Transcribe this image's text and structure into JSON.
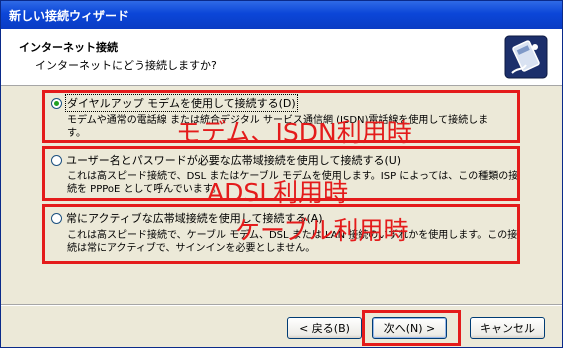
{
  "window": {
    "title": "新しい接続ウィザード"
  },
  "header": {
    "title": "インターネット接続",
    "subtitle": "インターネットにどう接続しますか?",
    "icon": "phone-plug-icon"
  },
  "options": [
    {
      "label": "ダイヤルアップ モデムを使用して接続する(D)",
      "checked": true,
      "description": [
        "モデムや通常の電話線 または統合デジタル サービス通信網 (ISDN)電話線を使用して接続しま",
        "す。"
      ],
      "annotation": "モデム、ISDN利用時"
    },
    {
      "label": "ユーザー名とパスワードが必要な広帯域接続を使用して接続する(U)",
      "checked": false,
      "description": [
        "これは高スピード接続で、DSL またはケーブル モデムを使用します。ISP によっては、この種類の接",
        "続を PPPoE として呼んでいます。"
      ],
      "annotation": "ADSL利用時"
    },
    {
      "label": "常にアクティブな広帯域接続を使用して接続する(A)",
      "checked": false,
      "description": [
        "これは高スピード接続で、ケーブル モデム、DSL または LAN 接続のいずれかを使用します。この接",
        "続は常にアクティブで、サインインを必要としません。"
      ],
      "annotation": "ケーブル利用時"
    }
  ],
  "buttons": {
    "back": "< 戻る(B)",
    "next": "次へ(N) >",
    "cancel": "キャンセル"
  },
  "colors": {
    "annotation_red": "#e41b1b",
    "title_bar": "#0b46d8",
    "radio_selected": "#21a121"
  }
}
